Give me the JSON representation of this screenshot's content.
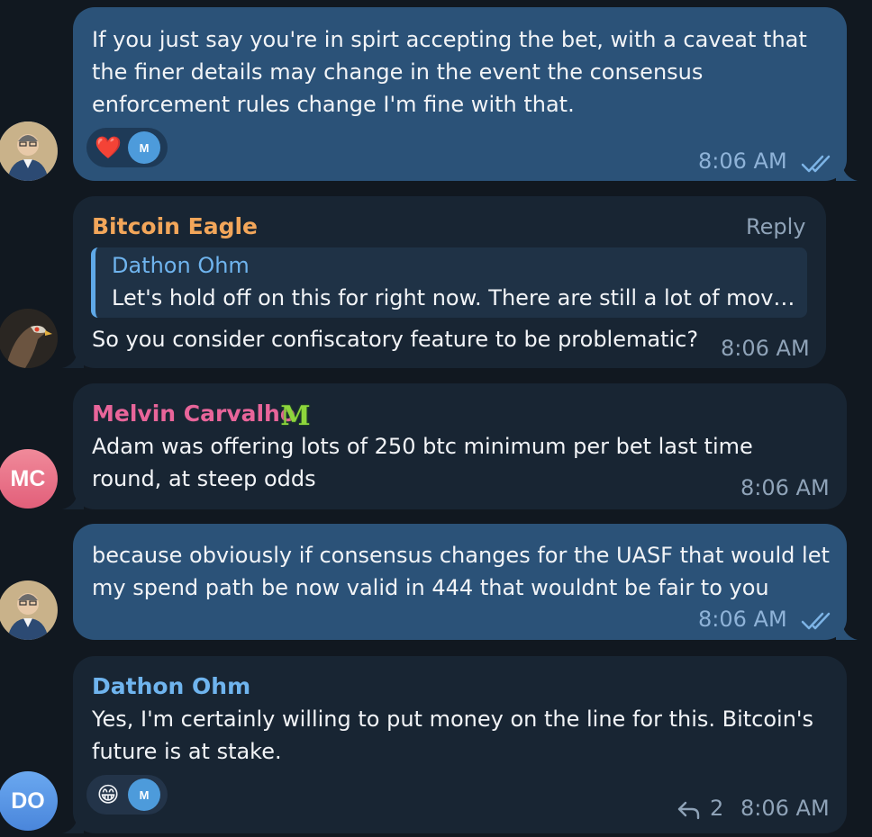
{
  "messages": [
    {
      "id": "m1",
      "type": "outgoing",
      "lines": [
        "If you just say you're in spirt accepting the bet, with a caveat that",
        "the finer details may change in the event the consensus",
        "enforcement rules change I'm fine with that."
      ],
      "reactions": {
        "emoji": "❤️",
        "avatar_initial": "M"
      },
      "time": "8:06 AM",
      "status": "double-check-icon"
    },
    {
      "id": "m2",
      "type": "incoming",
      "sender": "Bitcoin Eagle",
      "sender_color": "#f2a65a",
      "reply_action": "Reply",
      "quoted": {
        "author": "Dathon Ohm",
        "text": "Let's hold off on this for right now. There are still a lot of mov…"
      },
      "lines": [
        "So you consider confiscatory feature to be problematic?"
      ],
      "time": "8:06 AM"
    },
    {
      "id": "m3",
      "type": "incoming",
      "sender": "Melvin Carvalho",
      "sender_color": "#e8659a",
      "sender_badge": "M",
      "avatar_initials": "MC",
      "lines": [
        "Adam was offering lots of 250 btc minimum per bet last time",
        "round, at steep odds"
      ],
      "time": "8:06 AM"
    },
    {
      "id": "m4",
      "type": "outgoing",
      "lines": [
        "because obviously if consensus changes for the UASF that would let",
        "my spend path be now valid in 444 that wouldnt be fair to you"
      ],
      "time": "8:06 AM",
      "status": "double-check-icon"
    },
    {
      "id": "m5",
      "type": "incoming",
      "sender": "Dathon Ohm",
      "sender_color": "#6fb4ee",
      "avatar_initials": "DO",
      "lines": [
        "Yes, I'm certainly willing to put money on the line for this. Bitcoin's",
        "future is at stake."
      ],
      "reactions": {
        "emoji": "😁",
        "avatar_initial": "M"
      },
      "reply_count": "2",
      "time": "8:06 AM"
    }
  ],
  "colors": {
    "background": "#111820",
    "outgoing_bubble": "#2b5278",
    "incoming_bubble": "#182533",
    "accent": "#5fa9e8"
  }
}
